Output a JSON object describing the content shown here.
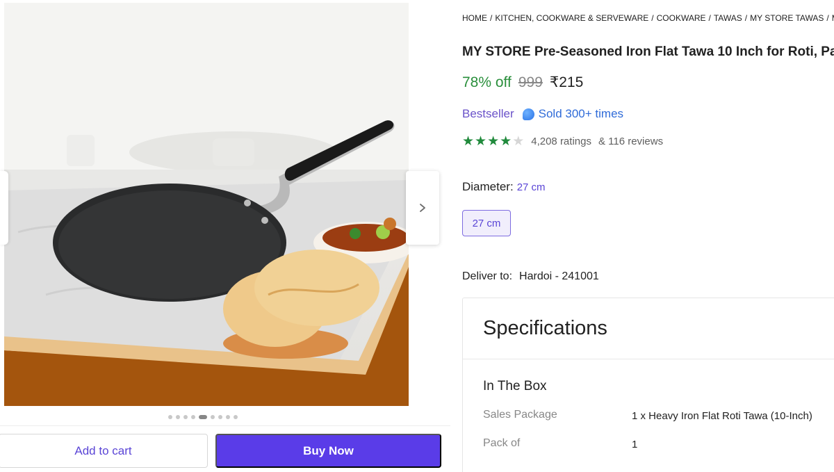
{
  "breadcrumb": [
    {
      "label": "HOME"
    },
    {
      "label": "KITCHEN, COOKWARE & SERVEWARE"
    },
    {
      "label": "COOKWARE"
    },
    {
      "label": "TAWAS"
    },
    {
      "label": "MY STORE TAWAS"
    },
    {
      "label": "MY"
    }
  ],
  "product": {
    "title": "MY STORE Pre-Seasoned Iron Flat Tawa 10 Inch for Roti, Pa",
    "discount": "78% off",
    "mrp": "999",
    "price": "₹215",
    "bestseller": "Bestseller",
    "sold": "Sold 300+ times",
    "rating_stars": 4,
    "ratings": "4,208 ratings",
    "reviews": "& 116 reviews"
  },
  "variant": {
    "label": "Diameter:",
    "value": "27 cm",
    "options": [
      "27 cm"
    ]
  },
  "delivery": {
    "label": "Deliver to:",
    "location": "Hardoi - 241001"
  },
  "specs": {
    "title": "Specifications",
    "section": "In The Box",
    "rows": [
      {
        "label": "Sales Package",
        "value": "1 x Heavy Iron Flat Roti Tawa (10-Inch)"
      },
      {
        "label": "Pack of",
        "value": "1"
      }
    ]
  },
  "gallery": {
    "image_count": 9,
    "active_index": 4
  },
  "actions": {
    "add_to_cart": "Add to cart",
    "buy_now": "Buy Now"
  },
  "colors": {
    "accent": "#5a3ce8",
    "discount": "#2a8f3c",
    "star": "#218a3c"
  }
}
